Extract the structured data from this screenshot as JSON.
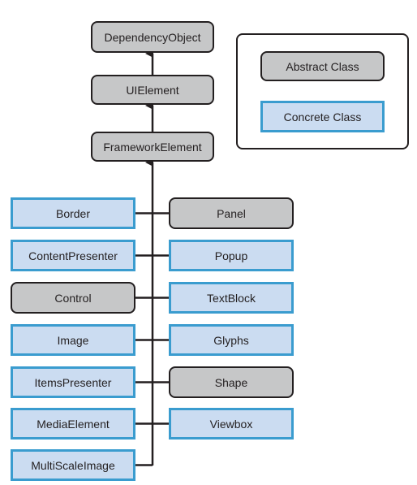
{
  "colors": {
    "abstract_fill": "#c6c7c8",
    "abstract_border": "#231f20",
    "concrete_fill": "#cbdcf1",
    "concrete_border": "#3a9ccf",
    "line": "#231f20"
  },
  "hierarchy": {
    "root": "DependencyObject",
    "level2": "UIElement",
    "level3": "FrameworkElement"
  },
  "legend": {
    "abstract_label": "Abstract Class",
    "concrete_label": "Concrete Class"
  },
  "left_children": [
    {
      "label": "Border",
      "kind": "concrete"
    },
    {
      "label": "ContentPresenter",
      "kind": "concrete"
    },
    {
      "label": "Control",
      "kind": "abstract"
    },
    {
      "label": "Image",
      "kind": "concrete"
    },
    {
      "label": "ItemsPresenter",
      "kind": "concrete"
    },
    {
      "label": "MediaElement",
      "kind": "concrete"
    },
    {
      "label": "MultiScaleImage",
      "kind": "concrete"
    }
  ],
  "right_children": [
    {
      "label": "Panel",
      "kind": "abstract"
    },
    {
      "label": "Popup",
      "kind": "concrete"
    },
    {
      "label": "TextBlock",
      "kind": "concrete"
    },
    {
      "label": "Glyphs",
      "kind": "concrete"
    },
    {
      "label": "Shape",
      "kind": "abstract"
    },
    {
      "label": "Viewbox",
      "kind": "concrete"
    }
  ]
}
